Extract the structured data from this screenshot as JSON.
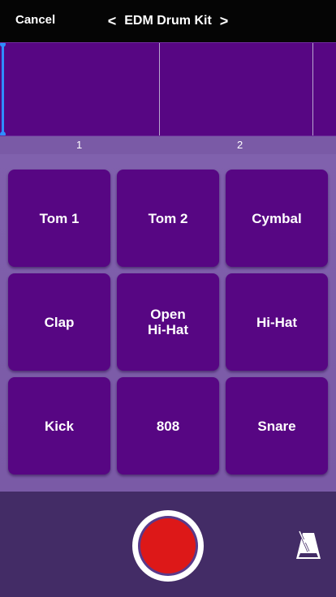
{
  "header": {
    "cancel_label": "Cancel",
    "title": "EDM Drum Kit",
    "prev_glyph": "<",
    "next_glyph": ">"
  },
  "timeline": {
    "measures": [
      "1",
      "2"
    ]
  },
  "pads": [
    {
      "label": "Tom 1"
    },
    {
      "label": "Tom 2"
    },
    {
      "label": "Cymbal"
    },
    {
      "label": "Clap"
    },
    {
      "label": "Open\nHi-Hat"
    },
    {
      "label": "Hi-Hat"
    },
    {
      "label": "Kick"
    },
    {
      "label": "808"
    },
    {
      "label": "Snare"
    }
  ],
  "controls": {
    "record_icon": "record-icon",
    "metronome_icon": "metronome-icon"
  },
  "colors": {
    "pad": "#570683",
    "background": "#7a5aa6",
    "header": "#050505",
    "bottom_bar": "#432c66",
    "record": "#dd1818",
    "playhead": "#2f8cff"
  }
}
